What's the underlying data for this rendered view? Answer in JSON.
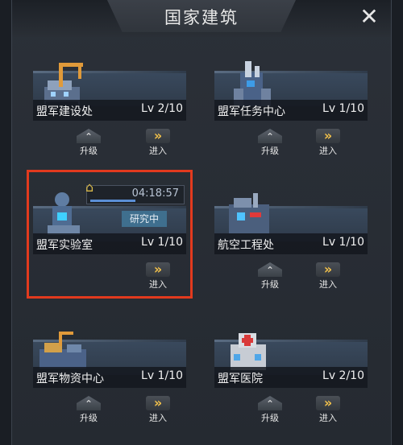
{
  "header": {
    "title": "国家建筑",
    "close_symbol": "✕"
  },
  "buttons": {
    "upgrade": "升级",
    "enter": "进入",
    "enter_symbol": "»",
    "upgrade_symbol": "⌃"
  },
  "buildings": [
    {
      "name": "盟军建设处",
      "level": "Lv 2/10"
    },
    {
      "name": "盟军任务中心",
      "level": "Lv 1/10"
    },
    {
      "name": "盟军实验室",
      "level": "Lv 1/10",
      "research_time": "04:18:57",
      "research_status": "研究中",
      "research_progress": 0.5
    },
    {
      "name": "航空工程处",
      "level": "Lv 1/10"
    },
    {
      "name": "盟军物资中心",
      "level": "Lv 1/10"
    },
    {
      "name": "盟军医院",
      "level": "Lv 2/10"
    }
  ],
  "colors": {
    "highlight": "#e23a1e",
    "research_bar": "#5b8fd6",
    "enter_accent": "#f2c14a"
  }
}
